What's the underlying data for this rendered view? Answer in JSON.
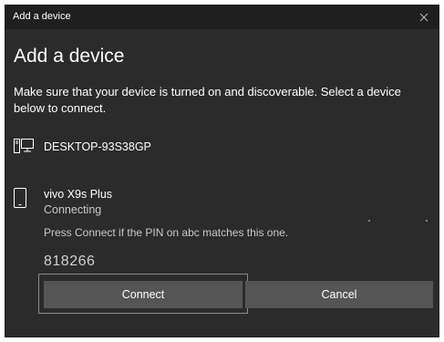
{
  "window": {
    "title": "Add a device",
    "close_icon": "close-icon"
  },
  "heading": "Add a device",
  "description": "Make sure that your device is turned on and discoverable. Select a device below to connect.",
  "devices": [
    {
      "name": "DESKTOP-93S38GP",
      "icon": "desktop-computer-icon"
    },
    {
      "name": "vivo X9s Plus",
      "icon": "phone-icon",
      "status": "Connecting",
      "prompt": "Press Connect if the PIN on abc matches this one.",
      "pin": "818266"
    }
  ],
  "buttons": {
    "connect": "Connect",
    "cancel": "Cancel"
  },
  "colors": {
    "background": "#2b2b2b",
    "titlebar": "#1f1f1f",
    "button": "#555555",
    "text": "#ffffff",
    "secondary_text": "#c8c8c8"
  }
}
